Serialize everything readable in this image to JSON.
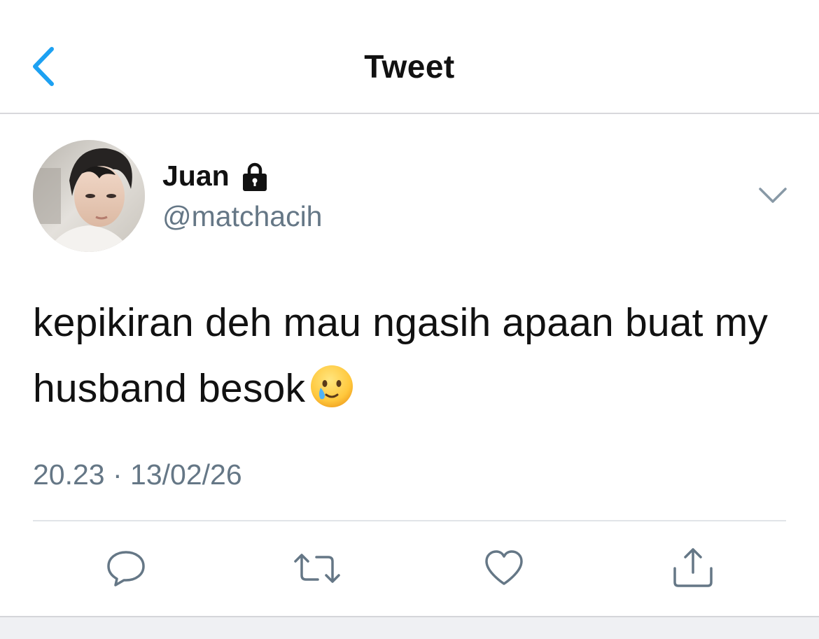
{
  "header": {
    "title": "Tweet",
    "back_icon": "chevron-left-icon",
    "accent_color": "#1da1f2"
  },
  "author": {
    "name": "Juan",
    "handle": "@matchacih",
    "protected_icon": "lock-icon",
    "avatar_icon": "avatar-photo"
  },
  "tweet": {
    "text": "kepikiran deh mau ngasih apaan buat my husband besok",
    "emoji_icon": "face-holding-back-tears-emoji",
    "timestamp": "20.23 · 13/02/26"
  },
  "actions": [
    {
      "icon": "reply-icon"
    },
    {
      "icon": "retweet-icon"
    },
    {
      "icon": "like-icon"
    },
    {
      "icon": "share-icon"
    }
  ],
  "colors": {
    "text_primary": "#111111",
    "text_secondary": "#657786",
    "icon_gray": "#657786",
    "divider": "#e1e4e8"
  }
}
